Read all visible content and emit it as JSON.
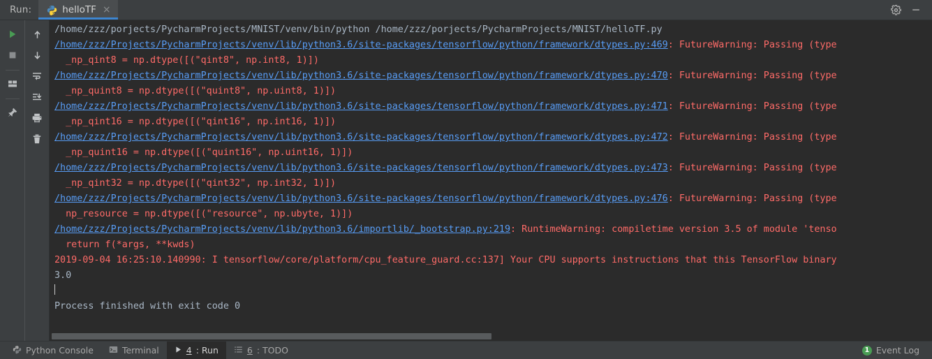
{
  "window": {
    "run_label": "Run:",
    "tab_label": "helloTF",
    "tab_close": "×",
    "tab_icon": "python-icon",
    "settings_icon": "gear-icon",
    "minimize_icon": "minimize-icon",
    "accent_color": "#3d86d1"
  },
  "toolbar_left": {
    "items": [
      {
        "name": "rerun-button",
        "icon": "play-icon",
        "title": "Rerun"
      },
      {
        "name": "stop-button",
        "icon": "stop-icon",
        "title": "Stop"
      },
      {
        "name": "restore-layout-button",
        "icon": "layout-icon",
        "title": "Restore Layout"
      },
      {
        "name": "pin-tab-button",
        "icon": "pin-icon",
        "title": "Pin Tab"
      }
    ]
  },
  "toolbar_right": {
    "items": [
      {
        "name": "up-button",
        "icon": "arrow-up-icon",
        "title": "Up the Stack Trace"
      },
      {
        "name": "down-button",
        "icon": "arrow-down-icon",
        "title": "Down the Stack Trace"
      },
      {
        "name": "soft-wrap-button",
        "icon": "soft-wrap-icon",
        "title": "Use Soft Wraps"
      },
      {
        "name": "scroll-to-end-button",
        "icon": "scroll-to-end-icon",
        "title": "Scroll to the end"
      },
      {
        "name": "print-button",
        "icon": "print-icon",
        "title": "Print"
      },
      {
        "name": "clear-all-button",
        "icon": "trash-icon",
        "title": "Clear All"
      }
    ]
  },
  "console": {
    "colors": {
      "text": "#a9b7c6",
      "error": "#ff6b68",
      "link": "#589df6",
      "background": "#2b2b2b"
    },
    "lines": [
      {
        "parts": [
          {
            "t": "/home/zzz/porjects/PycharmProjects/MNIST/venv/bin/python /home/zzz/porjects/PycharmProjects/MNIST/helloTF.py",
            "s": "normal"
          }
        ]
      },
      {
        "parts": [
          {
            "t": "/home/zzz/Projects/PycharmProjects/venv/lib/python3.6/site-packages/tensorflow/python/framework/dtypes.py:469",
            "s": "link"
          },
          {
            "t": ": FutureWarning: Passing (type",
            "s": "red"
          }
        ]
      },
      {
        "parts": [
          {
            "t": "  _np_qint8 = np.dtype([(\"qint8\", np.int8, 1)])",
            "s": "red"
          }
        ]
      },
      {
        "parts": [
          {
            "t": "/home/zzz/Projects/PycharmProjects/venv/lib/python3.6/site-packages/tensorflow/python/framework/dtypes.py:470",
            "s": "link"
          },
          {
            "t": ": FutureWarning: Passing (type",
            "s": "red"
          }
        ]
      },
      {
        "parts": [
          {
            "t": "  _np_quint8 = np.dtype([(\"quint8\", np.uint8, 1)])",
            "s": "red"
          }
        ]
      },
      {
        "parts": [
          {
            "t": "/home/zzz/Projects/PycharmProjects/venv/lib/python3.6/site-packages/tensorflow/python/framework/dtypes.py:471",
            "s": "link"
          },
          {
            "t": ": FutureWarning: Passing (type",
            "s": "red"
          }
        ]
      },
      {
        "parts": [
          {
            "t": "  _np_qint16 = np.dtype([(\"qint16\", np.int16, 1)])",
            "s": "red"
          }
        ]
      },
      {
        "parts": [
          {
            "t": "/home/zzz/Projects/PycharmProjects/venv/lib/python3.6/site-packages/tensorflow/python/framework/dtypes.py:472",
            "s": "link"
          },
          {
            "t": ": FutureWarning: Passing (type",
            "s": "red"
          }
        ]
      },
      {
        "parts": [
          {
            "t": "  _np_quint16 = np.dtype([(\"quint16\", np.uint16, 1)])",
            "s": "red"
          }
        ]
      },
      {
        "parts": [
          {
            "t": "/home/zzz/Projects/PycharmProjects/venv/lib/python3.6/site-packages/tensorflow/python/framework/dtypes.py:473",
            "s": "link"
          },
          {
            "t": ": FutureWarning: Passing (type",
            "s": "red"
          }
        ]
      },
      {
        "parts": [
          {
            "t": "  _np_qint32 = np.dtype([(\"qint32\", np.int32, 1)])",
            "s": "red"
          }
        ]
      },
      {
        "parts": [
          {
            "t": "/home/zzz/Projects/PycharmProjects/venv/lib/python3.6/site-packages/tensorflow/python/framework/dtypes.py:476",
            "s": "link"
          },
          {
            "t": ": FutureWarning: Passing (type",
            "s": "red"
          }
        ]
      },
      {
        "parts": [
          {
            "t": "  np_resource = np.dtype([(\"resource\", np.ubyte, 1)])",
            "s": "red"
          }
        ]
      },
      {
        "parts": [
          {
            "t": "/home/zzz/Projects/PycharmProjects/venv/lib/python3.6/importlib/_bootstrap.py:219",
            "s": "link"
          },
          {
            "t": ": RuntimeWarning: compiletime version 3.5 of module 'tenso",
            "s": "red"
          }
        ]
      },
      {
        "parts": [
          {
            "t": "  return f(*args, **kwds)",
            "s": "red"
          }
        ]
      },
      {
        "parts": [
          {
            "t": "2019-09-04 16:25:10.140990: I tensorflow/core/platform/cpu_feature_guard.cc:137] Your CPU supports instructions that this TensorFlow binary",
            "s": "red"
          }
        ]
      },
      {
        "parts": [
          {
            "t": "3.0",
            "s": "normal"
          }
        ]
      },
      {
        "parts": [
          {
            "t": "",
            "s": "caret"
          }
        ]
      },
      {
        "parts": [
          {
            "t": "Process finished with exit code 0",
            "s": "normal"
          }
        ]
      }
    ]
  },
  "statusbar": {
    "items": [
      {
        "name": "status-python-console",
        "icon": "python-console-icon",
        "label": "Python Console",
        "active": false
      },
      {
        "name": "status-terminal",
        "icon": "terminal-icon",
        "label": "Terminal",
        "active": false
      },
      {
        "name": "status-run",
        "icon": "play-icon",
        "num": "4",
        "label": ": Run",
        "active": true
      },
      {
        "name": "status-todo",
        "icon": "todo-icon",
        "num": "6",
        "label": ": TODO",
        "active": false
      }
    ],
    "event_log": {
      "label": "Event Log",
      "count": "1",
      "badge_color": "#499c54"
    }
  }
}
